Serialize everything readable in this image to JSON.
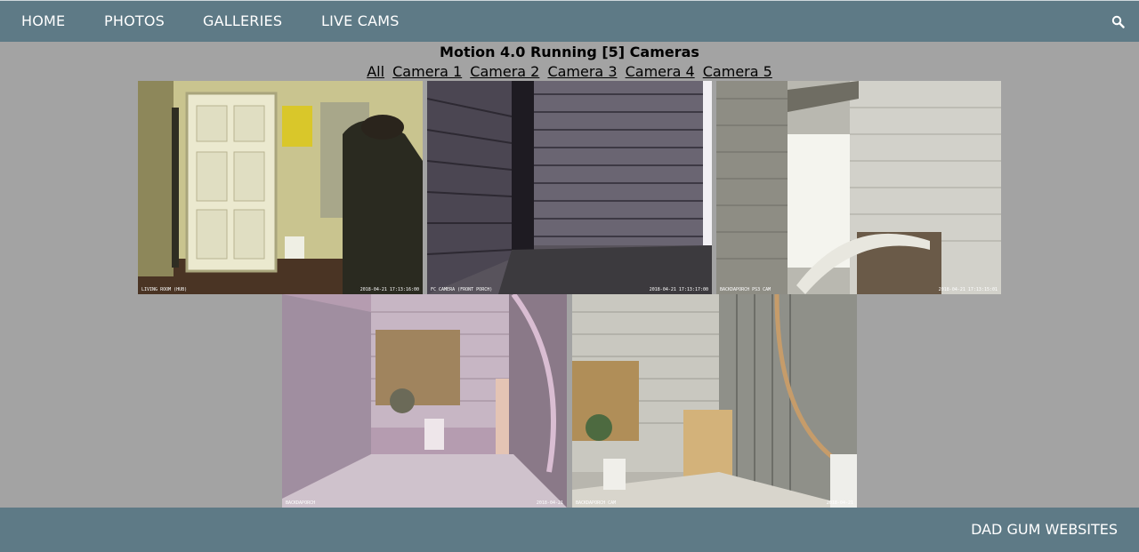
{
  "nav": {
    "items": [
      {
        "label": "HOME"
      },
      {
        "label": "PHOTOS"
      },
      {
        "label": "GALLERIES"
      },
      {
        "label": "LIVE CAMS"
      }
    ],
    "search_icon": "search-icon"
  },
  "page": {
    "title": "Motion 4.0 Running [5] Cameras",
    "camera_links": [
      "All",
      "Camera 1",
      "Camera 2",
      "Camera 3",
      "Camera 4",
      "Camera 5"
    ]
  },
  "cameras": [
    {
      "caption": "LIVING ROOM (HUB)",
      "timestamp": "2018-04-21 17:13:16:00"
    },
    {
      "caption": "FC CAMERA (FRONT PORCH)",
      "timestamp": "2018-04-21 17:13:17:00"
    },
    {
      "caption": "BACKDAPORCH PS3 CAM",
      "timestamp": "2018-04-21 17:13:15:01"
    },
    {
      "caption": "BACKDAPORCH",
      "timestamp": "2018-04-21"
    },
    {
      "caption": "BACKDAPORCH CAM",
      "timestamp": "2018-04-21"
    }
  ],
  "footer": {
    "brand": "DAD GUM WEBSITES"
  },
  "colors": {
    "nav_bg": "#5e7a86",
    "page_bg": "#a3a3a3"
  }
}
